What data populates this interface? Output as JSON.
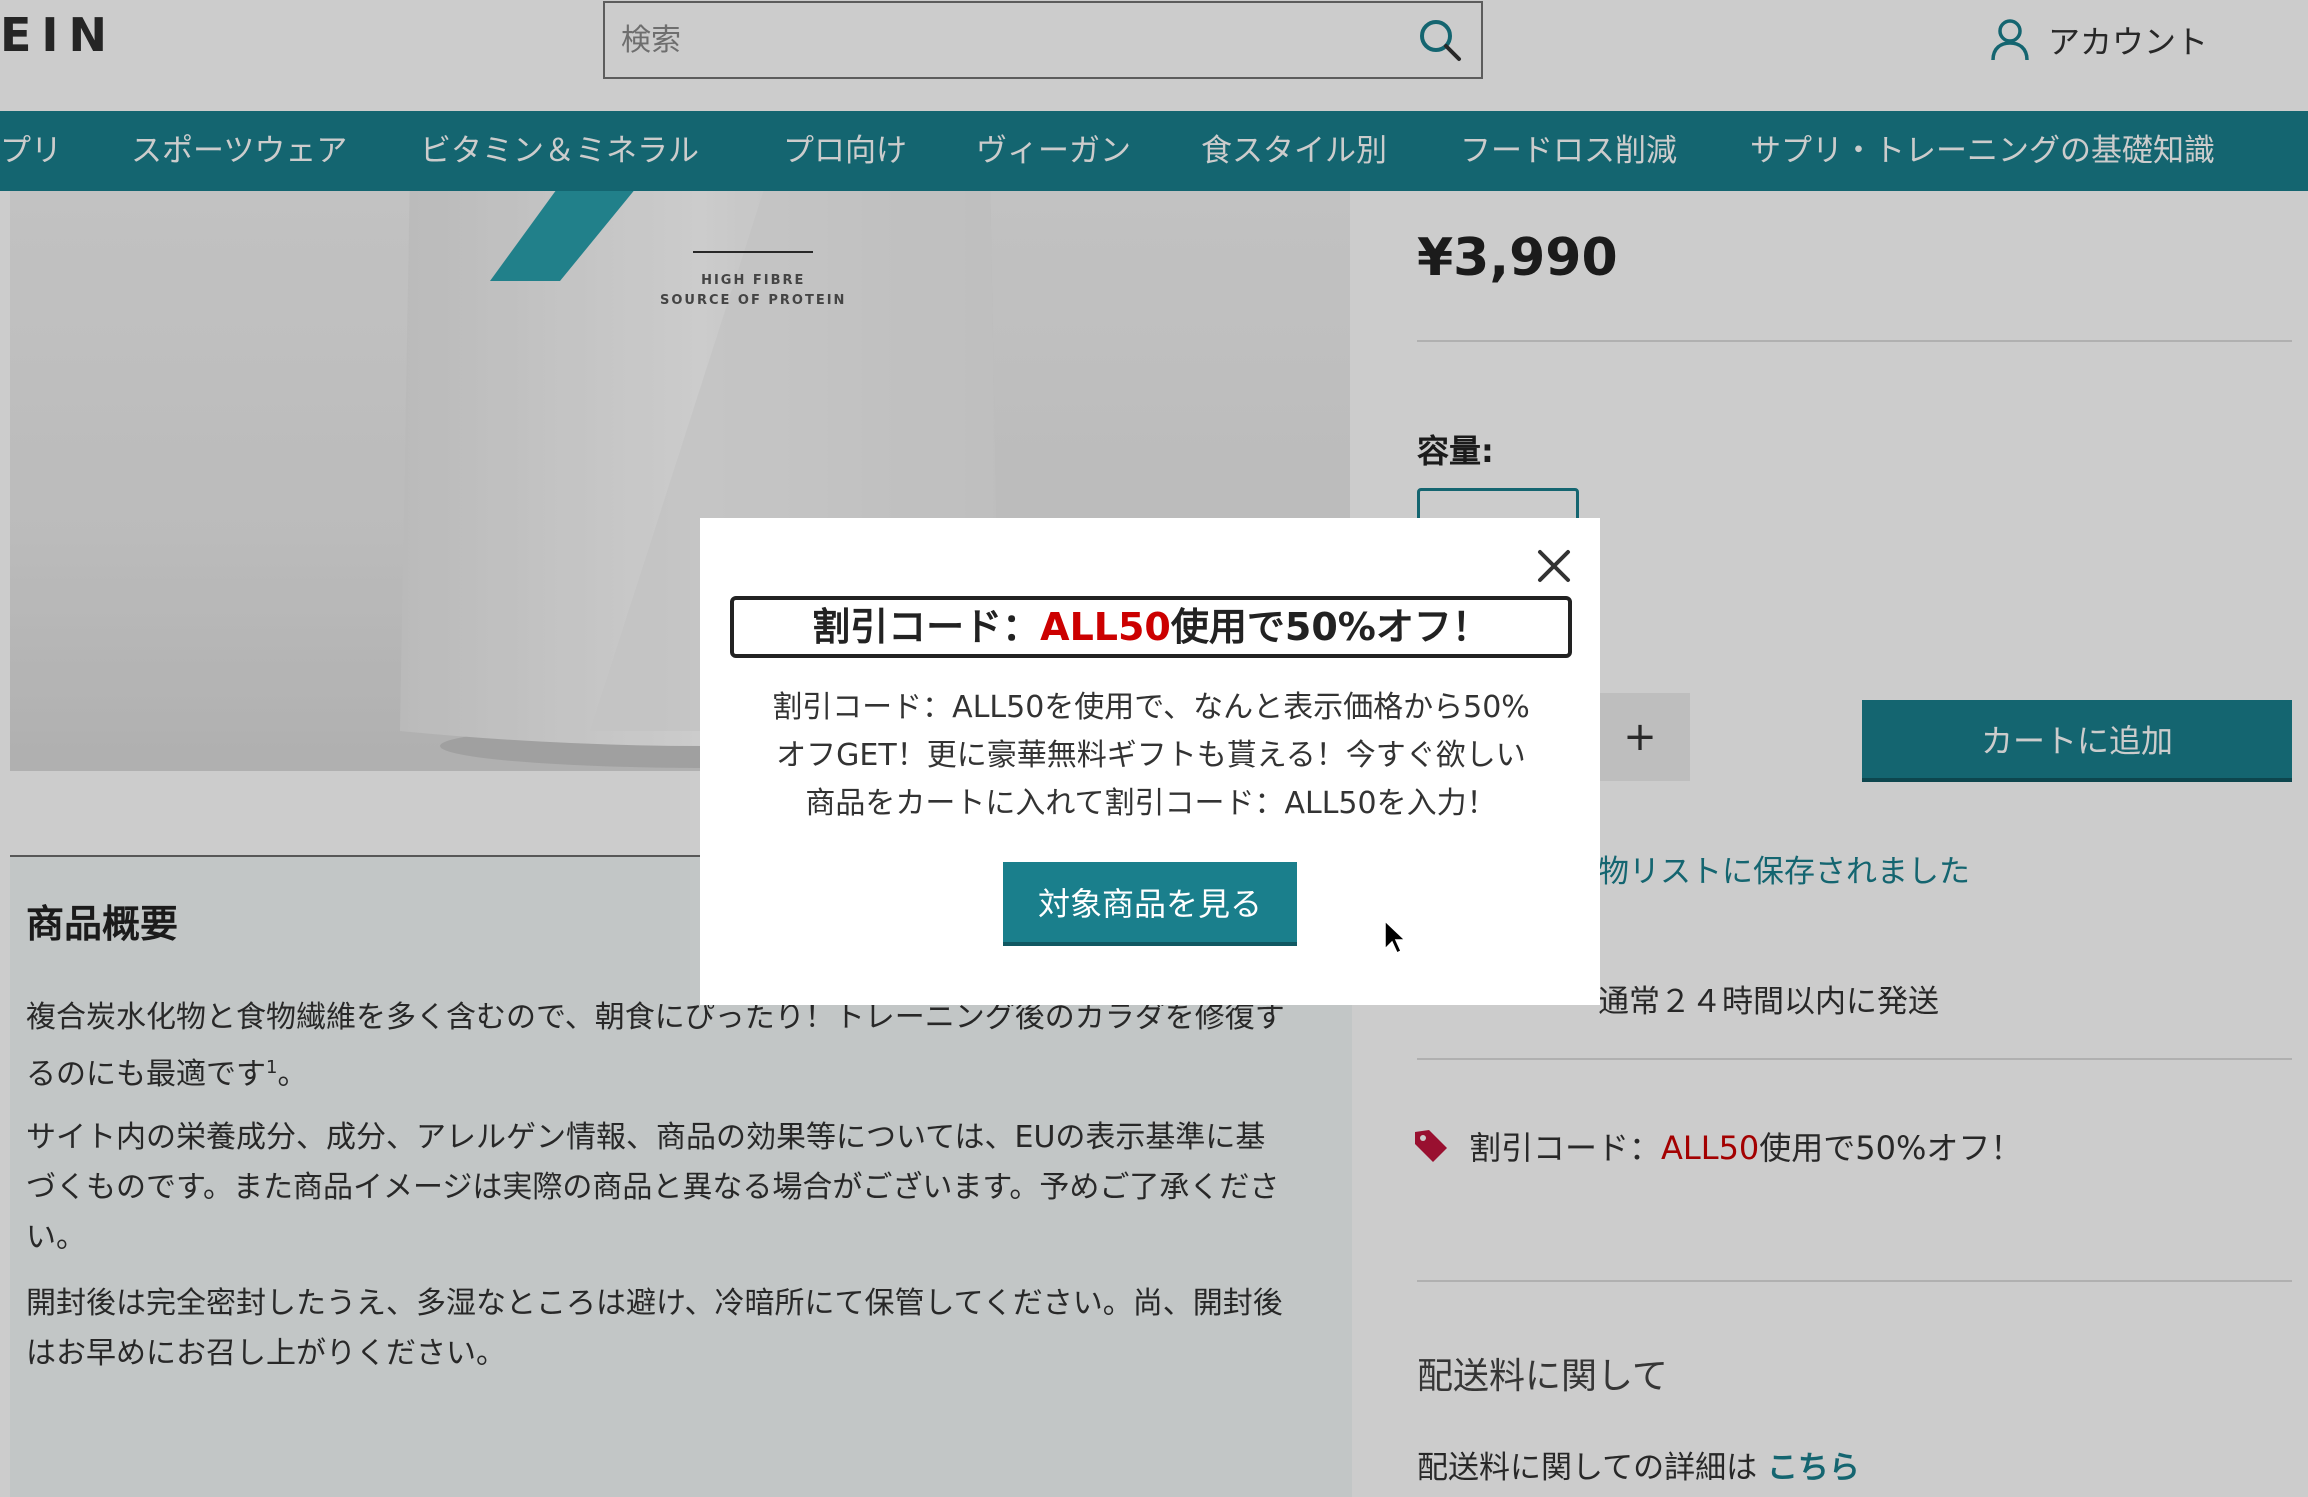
{
  "header": {
    "logo_text": "EIN",
    "search_placeholder": "検索",
    "search_icon": "search-icon",
    "account_label": "アカウント",
    "account_icon": "user-icon"
  },
  "nav": {
    "items": [
      "プリ",
      "スポーツウェア",
      "ビタミン＆ミネラル",
      "プロ向け",
      "ヴィーガン",
      "食スタイル別",
      "フードロス削減",
      "サプリ・トレーニングの基礎知識"
    ]
  },
  "product": {
    "bag_text": "HIGH FIBRE\nSOURCE OF PROTEIN",
    "price": "¥3,990",
    "size_label": "容量:",
    "qty_plus": "+",
    "add_to_cart": "カートに追加",
    "wishlist_msg": "物リストに保存されました",
    "shipping_msg": "通常２４時間以内に発送",
    "promo": {
      "icon": "tag-icon",
      "prefix": "割引コード：",
      "code": "ALL50",
      "suffix": "使用で50%オフ！"
    },
    "delivery_title": "配送料に関して",
    "delivery_detail": "配送料に関しての詳細は ",
    "delivery_link": "こちら"
  },
  "summary": {
    "title": "商品概要",
    "p1": "複合炭水化物と食物繊維を多く含むので、朝食にぴったり！トレーニング後のカラダを修復するのにも最適です",
    "p1_sup": "1",
    "p1_end": "。",
    "p2": "サイト内の栄養成分、成分、アレルゲン情報、商品の効果等については、EUの表示基準に基づくものです。また商品イメージは実際の商品と異なる場合がございます。予めご了承ください。",
    "p3": "開封後は完全密封したうえ、多湿なところは避け、冷暗所にて保管してください。尚、開封後はお早めにお召し上がりください。"
  },
  "modal": {
    "title_prefix": "割引コード：",
    "title_code": "ALL50",
    "title_suffix": "使用で50%オフ！",
    "body_line1": "割引コード：ALL50を使用で、なんと表示価格から50%",
    "body_line2": "オフGET！更に豪華無料ギフトも貰える！今すぐ欲しい",
    "body_line3": "商品をカートに入れて割引コード：ALL50を入力！",
    "cta": "対象商品を見る",
    "close_icon": "close-icon"
  },
  "colors": {
    "brand_teal": "#1a7f8c",
    "code_red": "#cc0000"
  }
}
